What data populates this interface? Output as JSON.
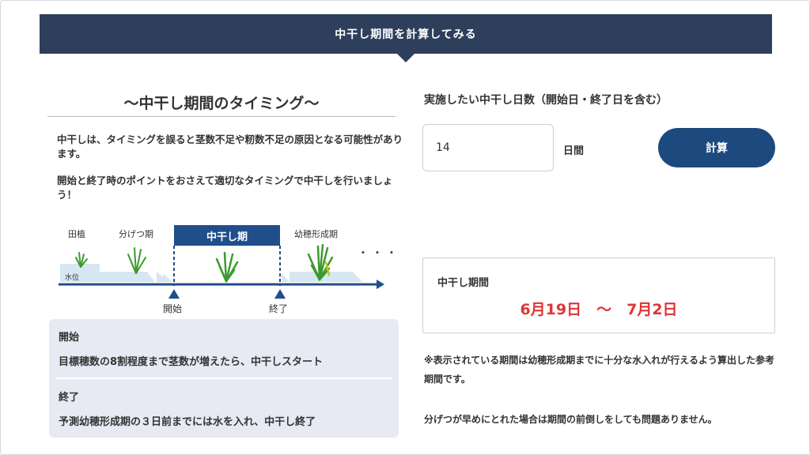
{
  "header": {
    "title": "中干し期間を計算してみる"
  },
  "timing": {
    "title": "～中干し期間のタイミング～",
    "description_1": "中干しは、タイミングを誤ると茎数不足や籾数不足の原因となる可能性があります。",
    "description_2": "開始と終了時のポイントをおさえて適切なタイミングで中干しを行いましょう！"
  },
  "diagram": {
    "stages": [
      "田植",
      "分げつ期",
      "幼穂形成期"
    ],
    "phase_label": "中干し期",
    "water_label": "水位",
    "continuation": "・・・",
    "start_label": "開始",
    "end_label": "終了"
  },
  "points": {
    "start_title": "開始",
    "start_text": "目標穂数の8割程度まで茎数が増えたら、中干しスタート",
    "end_title": "終了",
    "end_text": "予測幼穂形成期の３日前までには水を入れ、中干し終了"
  },
  "form": {
    "days_label": "実施したい中干し日数（開始日・終了日を含む）",
    "days_value": "14",
    "unit_label": "日間",
    "calc_button": "計算"
  },
  "result": {
    "title": "中干し期間",
    "value": "6月19日　～　7月2日"
  },
  "notes": {
    "note_1": "※表示されている期間は幼穂形成期までに十分な水入れが行えるよう算出した参考期間です。",
    "note_2": "分げつが早めにとれた場合は期間の前倒しをしても問題ありません。"
  },
  "colors": {
    "header_bg": "#2e3f5c",
    "accent_blue": "#1d4a7e",
    "result_red": "#e03535",
    "plant_green": "#3c9a2e",
    "water_blue": "#d6e6f2",
    "points_bg": "#e7eaf3"
  }
}
